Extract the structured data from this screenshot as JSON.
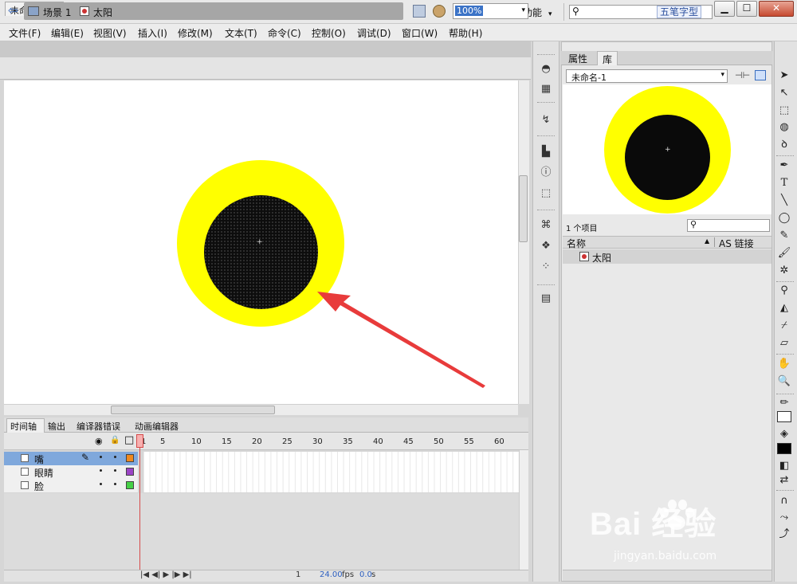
{
  "app": {
    "logo": "Fl",
    "workspace": "基本功能",
    "workspace_arrow": "▾",
    "dictionary_ime": "五笔字型",
    "min": "▁",
    "max": "☐",
    "close": "✕"
  },
  "menu": [
    "文件(F)",
    "编辑(E)",
    "视图(V)",
    "插入(I)",
    "修改(M)",
    "文本(T)",
    "命令(C)",
    "控制(O)",
    "调试(D)",
    "窗口(W)",
    "帮助(H)"
  ],
  "document_tab": {
    "label": "未命名-1*",
    "close": "×"
  },
  "edit_bar": {
    "back": "⇦",
    "scene": "场景 1",
    "symbol": "太阳",
    "zoom": "100%",
    "zoom_arrow": "▾"
  },
  "stage": {
    "sun_color": "#ffff00",
    "eye_color": "#0d0d0d",
    "arrow_color": "#e83b3b",
    "cross": "+"
  },
  "timeline": {
    "tabs": [
      "时间轴",
      "输出",
      "编译器错误",
      "动画编辑器"
    ],
    "column_icons": [
      "eye-icon",
      "lock-icon",
      "outline-icon"
    ],
    "eye_glyph": "◉",
    "lock_glyph": "🔒",
    "outline_glyph": "□",
    "frame_numbers": [
      "1",
      "5",
      "10",
      "15",
      "20",
      "25",
      "30",
      "35",
      "40",
      "45",
      "50",
      "55",
      "60"
    ],
    "layers": [
      {
        "name": "嘴",
        "color": "#f0891e",
        "selected": true,
        "pencil": "✎"
      },
      {
        "name": "眼睛",
        "color": "#9b44c6",
        "selected": false
      },
      {
        "name": "脸",
        "color": "#46d046",
        "selected": false
      }
    ],
    "bottom": {
      "controls": "|◀ ◀| ▶ |▶ ▶|",
      "current_frame": "1",
      "fps": "24.00",
      "fps_unit": "fps",
      "time": "0.0",
      "time_unit": "s"
    }
  },
  "library": {
    "tabs": [
      "属性",
      "库"
    ],
    "document": "未命名-1",
    "doc_arrow": "▾",
    "count": "1 个项目",
    "search_glyph": "⚲",
    "columns": {
      "name": "名称",
      "as_link": "AS 链接",
      "sort": "▲"
    },
    "items": [
      "太阳"
    ],
    "preview": {
      "sun_color": "#ffff00",
      "eye_color": "#0a0a0a",
      "cross": "+"
    }
  },
  "watermark": {
    "text": "Bai  经验",
    "url": "jingyan.baidu.com"
  }
}
